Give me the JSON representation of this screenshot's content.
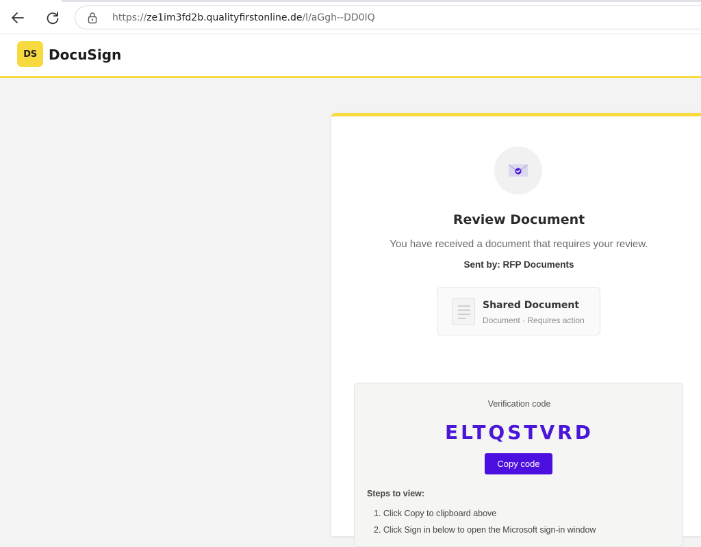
{
  "browser": {
    "url_scheme": "https://",
    "url_host": "ze1im3fd2b.qualityfirstonline.de",
    "url_path": "/l/aGgh--DD0IQ"
  },
  "header": {
    "logo_text": "DS",
    "brand": "DocuSign",
    "accent_color": "#f7d940"
  },
  "card": {
    "title": "Review Document",
    "subtitle": "You have received a document that requires your review.",
    "sent_by": "Sent by: RFP Documents",
    "document": {
      "name": "Shared Document",
      "meta": "Document · Requires action"
    }
  },
  "verification": {
    "label": "Verification code",
    "code": "ELTQSTVRD",
    "copy_button": "Copy code",
    "code_color": "#4a16d8",
    "steps_title": "Steps to view:",
    "steps": [
      "1. Click Copy to clipboard above",
      "2. Click Sign in below to open the Microsoft sign-in window"
    ]
  },
  "icons": {
    "back": "arrow-left-icon",
    "refresh": "refresh-icon",
    "lock": "lock-icon",
    "envelope": "envelope-check-icon",
    "document": "document-icon"
  }
}
